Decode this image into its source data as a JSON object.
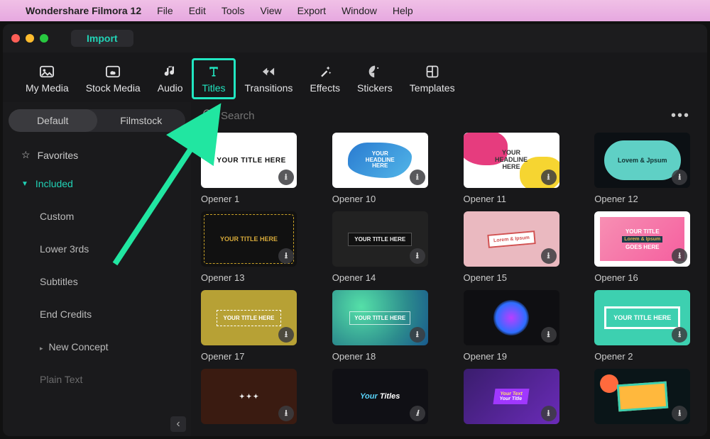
{
  "menubar": {
    "app_name": "Wondershare Filmora 12",
    "items": [
      "File",
      "Edit",
      "Tools",
      "View",
      "Export",
      "Window",
      "Help"
    ]
  },
  "titlebar": {
    "import_label": "Import"
  },
  "toolbar": {
    "items": [
      {
        "label": "My Media"
      },
      {
        "label": "Stock Media"
      },
      {
        "label": "Audio"
      },
      {
        "label": "Titles"
      },
      {
        "label": "Transitions"
      },
      {
        "label": "Effects"
      },
      {
        "label": "Stickers"
      },
      {
        "label": "Templates"
      }
    ],
    "selected_index": 3
  },
  "sidebar": {
    "segment": {
      "default": "Default",
      "filmstock": "Filmstock"
    },
    "favorites_label": "Favorites",
    "included_label": "Included",
    "categories": [
      "Custom",
      "Lower 3rds",
      "Subtitles",
      "End Credits",
      "New Concept",
      "Plain Text"
    ]
  },
  "search": {
    "placeholder": "Search"
  },
  "cards": [
    {
      "label": "Opener 1"
    },
    {
      "label": "Opener 10"
    },
    {
      "label": "Opener 11"
    },
    {
      "label": "Opener 12"
    },
    {
      "label": "Opener 13"
    },
    {
      "label": "Opener 14"
    },
    {
      "label": "Opener 15"
    },
    {
      "label": "Opener 16"
    },
    {
      "label": "Opener 17"
    },
    {
      "label": "Opener 18"
    },
    {
      "label": "Opener 19"
    },
    {
      "label": "Opener 2"
    }
  ],
  "thumb_text": {
    "t1": "YOUR TITLE HERE",
    "t2a": "YOUR",
    "t2b": "HEADLINE",
    "t2c": "HERE",
    "t3a": "YOUR",
    "t3b": "HEADLINE",
    "t3c": "HERE",
    "t4a": "Lovem & Jpsum",
    "t5": "YOUR TITLE HERE",
    "t6": "YOUR TITLE HERE",
    "t7": "Lorem & Ipsum",
    "t8a": "YOUR TITLE",
    "t8b": "Lorem & Ipsum",
    "t8c": "GOES HERE",
    "t9": "YOUR TITLE HERE",
    "t10": "YOUR TITLE HERE",
    "t12a": "YOUR TITLE HERE",
    "t14a": "Your ",
    "t14b": "Titles",
    "t15a": "Your Text",
    "t15b": "Your Title"
  }
}
